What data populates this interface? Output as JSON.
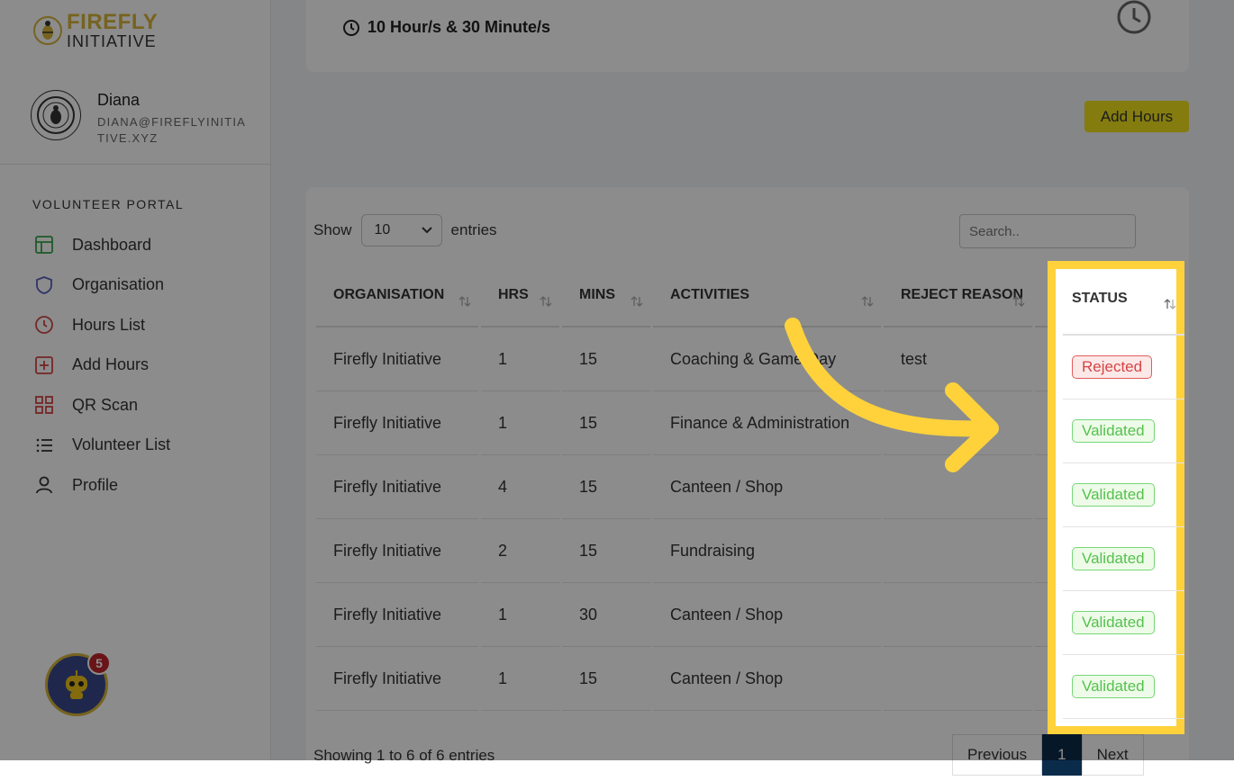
{
  "brand": {
    "line1": "FIREFLY",
    "line2": "INITIATIVE"
  },
  "user": {
    "name": "Diana",
    "email": "DIANA@FIREFLYINITIATIVE.XYZ"
  },
  "sidebar": {
    "section_label": "VOLUNTEER PORTAL",
    "items": [
      {
        "label": "Dashboard",
        "icon": "dashboard-icon",
        "color": "#3aa34a"
      },
      {
        "label": "Organisation",
        "icon": "shield-icon",
        "color": "#5a5fbf"
      },
      {
        "label": "Hours List",
        "icon": "clock-icon",
        "color": "#d54545"
      },
      {
        "label": "Add Hours",
        "icon": "plus-square-icon",
        "color": "#d54545"
      },
      {
        "label": "QR Scan",
        "icon": "grid-icon",
        "color": "#d54545"
      },
      {
        "label": "Volunteer List",
        "icon": "list-icon",
        "color": "#333333"
      },
      {
        "label": "Profile",
        "icon": "user-icon",
        "color": "#333333"
      }
    ]
  },
  "notifications": {
    "count": "5"
  },
  "summary": {
    "total_time": "10 Hour/s & 30 Minute/s"
  },
  "actions": {
    "add_hours": "Add Hours"
  },
  "table_controls": {
    "show_label": "Show",
    "page_size": "10",
    "entries_label": "entries",
    "search_placeholder": "Search.."
  },
  "table": {
    "headers": [
      "ORGANISATION",
      "HRS",
      "MINS",
      "ACTIVITIES",
      "REJECT REASON",
      "STATUS"
    ],
    "rows": [
      {
        "organisation": "Firefly Initiative",
        "hrs": "1",
        "mins": "15",
        "activities": "Coaching & Game Day",
        "reject_reason": "test",
        "status": "Rejected"
      },
      {
        "organisation": "Firefly Initiative",
        "hrs": "1",
        "mins": "15",
        "activities": "Finance & Administration",
        "reject_reason": "",
        "status": "Validated"
      },
      {
        "organisation": "Firefly Initiative",
        "hrs": "4",
        "mins": "15",
        "activities": "Canteen / Shop",
        "reject_reason": "",
        "status": "Validated"
      },
      {
        "organisation": "Firefly Initiative",
        "hrs": "2",
        "mins": "15",
        "activities": "Fundraising",
        "reject_reason": "",
        "status": "Validated"
      },
      {
        "organisation": "Firefly Initiative",
        "hrs": "1",
        "mins": "30",
        "activities": "Canteen / Shop",
        "reject_reason": "",
        "status": "Validated"
      },
      {
        "organisation": "Firefly Initiative",
        "hrs": "1",
        "mins": "15",
        "activities": "Canteen / Shop",
        "reject_reason": "",
        "status": "Validated"
      }
    ]
  },
  "footer": {
    "showing": "Showing 1 to 6 of 6 entries",
    "previous": "Previous",
    "page": "1",
    "next": "Next"
  },
  "colors": {
    "accent_yellow": "#ffd23c",
    "button_yellow": "#f0e21d",
    "brand_gold": "#d8b53a",
    "pager_active": "#0b2b4a"
  }
}
